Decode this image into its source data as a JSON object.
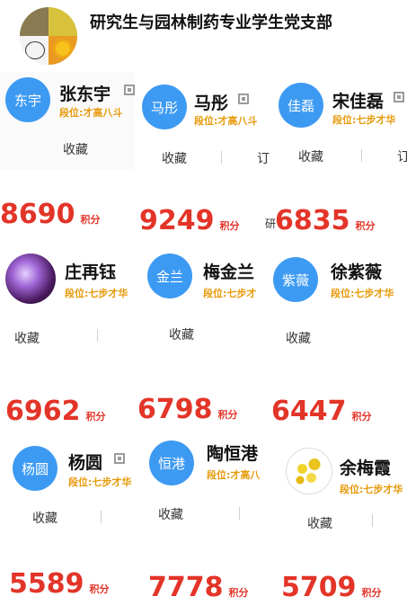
{
  "header": {
    "title": "研究生与园林制药专业学生党支部",
    "logo_icon": "group-logo-collage"
  },
  "colors": {
    "accent_blue": "#3d9af2",
    "score_red": "#e33428",
    "rank_orange": "#e79a0b"
  },
  "labels": {
    "fav": "收藏",
    "unit": "积分",
    "dingyue_trunc": "订",
    "tail_trunc": "研"
  },
  "members": [
    {
      "name": "张东宇",
      "avatar_text": "东宇",
      "rank": "段位:才高八斗",
      "score": "8690"
    },
    {
      "name": "马彤",
      "avatar_text": "马彤",
      "rank": "段位:才高八斗",
      "score": "9249"
    },
    {
      "name": "宋佳磊",
      "avatar_text": "佳磊",
      "rank": "段位:七步才华",
      "score": "6835"
    },
    {
      "name": "庄再钰",
      "avatar_text": "",
      "rank": "段位:七步才华",
      "score": "6962"
    },
    {
      "name": "梅金兰",
      "avatar_text": "金兰",
      "rank": "段位:七步才",
      "score": "6798"
    },
    {
      "name": "徐紫薇",
      "avatar_text": "紫薇",
      "rank": "段位:七步才华",
      "score": "6447"
    },
    {
      "name": "杨圆",
      "avatar_text": "杨圆",
      "rank": "段位:七步才华",
      "score": "5589"
    },
    {
      "name": "陶恒港",
      "avatar_text": "恒港",
      "rank": "段位:才高八",
      "score": "7778"
    },
    {
      "name": "余梅霞",
      "avatar_text": "",
      "rank": "段位:七步才华",
      "score": "5709"
    }
  ]
}
